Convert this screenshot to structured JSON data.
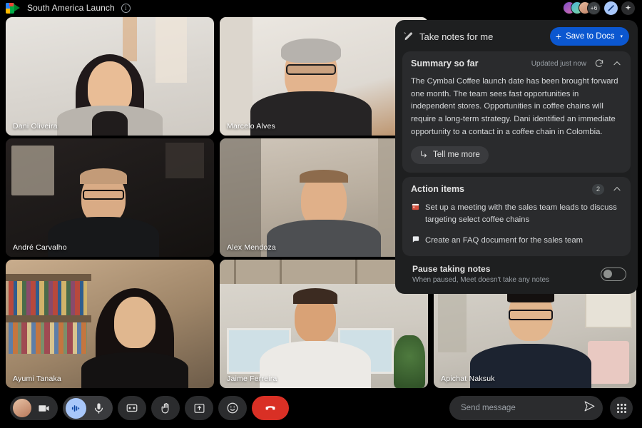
{
  "topbar": {
    "logo_icon": "google-meet-icon",
    "title": "South America Launch",
    "info_icon": "info-icon",
    "overflow_count": "+6",
    "effects_icon": "visual-effects-icon",
    "gemini_icon": "gemini-sparkle-icon"
  },
  "participants": [
    {
      "name": "Dani Oliveira"
    },
    {
      "name": "Marcelo Alves"
    },
    {
      "name": "André Carvalho"
    },
    {
      "name": "Alex Mendoza"
    },
    {
      "name": "Ayumi Tanaka"
    },
    {
      "name": "Jaime Ferreira"
    },
    {
      "name": "Apichat Naksuk"
    }
  ],
  "notes_panel": {
    "icon": "take-notes-pen-icon",
    "title": "Take notes for me",
    "save_button": {
      "plus": "+",
      "label": "Save to Docs",
      "caret": "▾",
      "color": "#0b57d0"
    },
    "summary": {
      "title": "Summary so far",
      "updated": "Updated just now",
      "refresh_icon": "refresh-icon",
      "collapse_icon": "chevron-up-icon",
      "body": "The Cymbal Coffee launch date has been brought forward one month. The team sees fast opportunities in independent stores. Opportunities in coffee chains will require a long-term strategy. Dani identified an immediate opportunity to a contact in a coffee chain in Colombia.",
      "tell_me_more": "Tell me more",
      "tell_me_more_icon": "arrow-turn-down-right-icon"
    },
    "action_items": {
      "title": "Action items",
      "count": "2",
      "collapse_icon": "chevron-up-icon",
      "items": [
        {
          "icon": "calendar-icon",
          "text": "Set up a meeting with the sales team leads to discuss targeting select coffee chains"
        },
        {
          "icon": "chat-bubble-icon",
          "text": "Create an FAQ document for the sales team"
        }
      ]
    },
    "pause": {
      "label": "Pause taking notes",
      "description": "When paused, Meet doesn't take any notes",
      "state": "off"
    }
  },
  "bottombar": {
    "avatar": "self-avatar",
    "camera_icon": "camera-icon",
    "audio_icon": "audio-waveform-icon",
    "mic_icon": "microphone-icon",
    "captions_icon": "closed-captions-icon",
    "raise_hand_icon": "raise-hand-icon",
    "present_icon": "present-screen-icon",
    "emoji_icon": "emoji-reaction-icon",
    "end_call_icon": "end-call-icon",
    "end_call_color": "#d93025",
    "message_placeholder": "Send message",
    "message_value": "",
    "send_icon": "send-icon",
    "apps_icon": "apps-grid-icon"
  }
}
